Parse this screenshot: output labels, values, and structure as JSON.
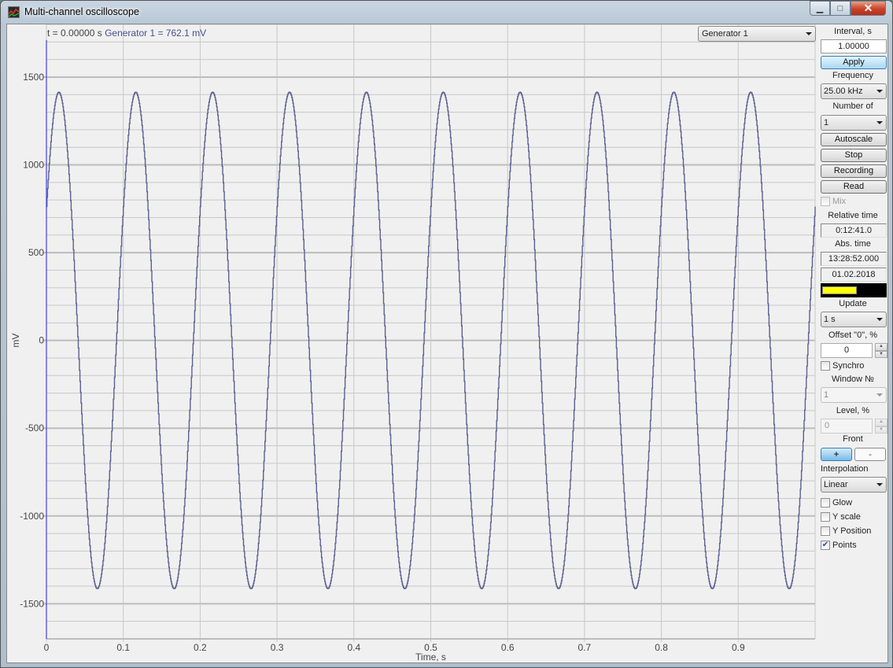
{
  "window": {
    "title": "Multi-channel oscilloscope",
    "controls": {
      "minimize": "▁",
      "maximize": "□",
      "close": "✕"
    }
  },
  "readout": {
    "time_text": "t = 0.00000 s",
    "channel_text": "Generator 1 = 762.1 mV"
  },
  "channel_select": {
    "value": "Generator 1"
  },
  "panel": {
    "interval_label": "Interval, s",
    "interval_value": "1.00000",
    "apply_label": "Apply",
    "frequency_label": "Frequency",
    "frequency_value": "25.00 kHz",
    "channels_label": "Number of",
    "channels_value": "1",
    "autoscale_label": "Autoscale",
    "stop_label": "Stop",
    "recording_label": "Recording",
    "read_label": "Read",
    "mix_label": "Mix",
    "mix_checked": false,
    "relative_time_label": "Relative time",
    "relative_time_value": "0:12:41.0",
    "abs_time_label": "Abs. time",
    "abs_time_value": "13:28:52.000",
    "date_value": "01.02.2018",
    "buffer_fill_fraction": 0.55,
    "buffer_color": "#ffff00",
    "update_label": "Update",
    "update_value": "1 s",
    "offset_label": "Offset \"0\", %",
    "offset_value": "0",
    "synchro_label": "Synchro",
    "synchro_checked": false,
    "window_no_label": "Window №",
    "window_no_value": "1",
    "level_label": "Level, %",
    "level_value": "0",
    "front_label": "Front",
    "front_plus": "+",
    "front_minus": "-",
    "interpolation_label": "Interpolation",
    "interpolation_value": "Linear",
    "glow_label": "Glow",
    "yscale_label": "Y scale",
    "yposition_label": "Y Position",
    "points_label": "Points",
    "checks": {
      "glow": false,
      "yscale": false,
      "yposition": false,
      "points": true
    }
  },
  "chart_data": {
    "type": "line",
    "title": "",
    "xlabel": "Time, s",
    "ylabel": "mV",
    "xlim": [
      0,
      1.0
    ],
    "ylim": [
      -1700,
      1800
    ],
    "x_ticks": [
      0,
      0.1,
      0.2,
      0.3,
      0.4,
      0.5,
      0.6,
      0.7,
      0.8,
      0.9
    ],
    "x_tick_labels": [
      "0",
      "0.1",
      "0.2",
      "0.3",
      "0.4",
      "0.5",
      "0.6",
      "0.7",
      "0.8",
      "0.9"
    ],
    "y_ticks": [
      1500,
      1000,
      500,
      0,
      -500,
      -1000,
      -1500
    ],
    "y_tick_labels": [
      "1500",
      "1000",
      "500",
      "0",
      "-500",
      "-1000",
      "-1500"
    ],
    "y_minor_step": 100,
    "grid": true,
    "series": [
      {
        "name": "Generator 1",
        "color": "#5c5f90",
        "function": "sine",
        "amplitude_mV": 1414,
        "frequency_Hz": 10,
        "value_at_t0_mV": 762.1,
        "rising_at_t0": true,
        "step_display": true
      }
    ],
    "cursor_t": 0,
    "cursor_color": "#4040e0"
  }
}
